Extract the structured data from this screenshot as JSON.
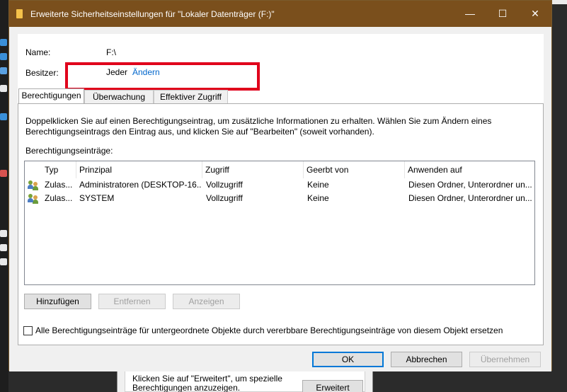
{
  "window": {
    "title": "Erweiterte Sicherheitseinstellungen für \"Lokaler Datenträger (F:)\"",
    "minimize_glyph": "—",
    "maximize_glyph": "☐",
    "close_glyph": "✕"
  },
  "info": {
    "name_label": "Name:",
    "name_value": "F:\\",
    "owner_label": "Besitzer:",
    "owner_value": "Jeder",
    "owner_change_link": "Ändern"
  },
  "tabs": [
    {
      "label": "Berechtigungen",
      "active": true
    },
    {
      "label": "Überwachung",
      "active": false
    },
    {
      "label": "Effektiver Zugriff",
      "active": false
    }
  ],
  "panel": {
    "description": "Doppelklicken Sie auf einen Berechtigungseintrag, um zusätzliche Informationen zu erhalten. Wählen Sie zum Ändern eines Berechtigungseintrags den Eintrag aus, und klicken Sie auf \"Bearbeiten\" (soweit vorhanden).",
    "entries_label": "Berechtigungseinträge:",
    "columns": [
      "Typ",
      "Prinzipal",
      "Zugriff",
      "Geerbt von",
      "Anwenden auf"
    ],
    "rows": [
      {
        "type": "Zulas...",
        "principal": "Administratoren (DESKTOP-16...",
        "access": "Vollzugriff",
        "inherited": "Keine",
        "applies": "Diesen Ordner, Unterordner un...",
        "icon": "users-icon"
      },
      {
        "type": "Zulas...",
        "principal": "SYSTEM",
        "access": "Vollzugriff",
        "inherited": "Keine",
        "applies": "Diesen Ordner, Unterordner un...",
        "icon": "users-icon"
      }
    ],
    "buttons": {
      "add": "Hinzufügen",
      "remove": "Entfernen",
      "view": "Anzeigen"
    },
    "replace_checkbox_label": "Alle Berechtigungseinträge für untergeordnete Objekte durch vererbbare Berechtigungseinträge von diesem Objekt ersetzen",
    "replace_checked": false
  },
  "footer": {
    "ok": "OK",
    "cancel": "Abbrechen",
    "apply": "Übernehmen"
  },
  "back_dialog": {
    "text": "Klicken Sie auf \"Erweitert\", um spezielle Berechtigungen anzuzeigen.",
    "button": "Erweitert"
  },
  "colors": {
    "titlebar": "#7a4f1c",
    "highlight_box": "#e0001b",
    "link": "#0066cc"
  }
}
